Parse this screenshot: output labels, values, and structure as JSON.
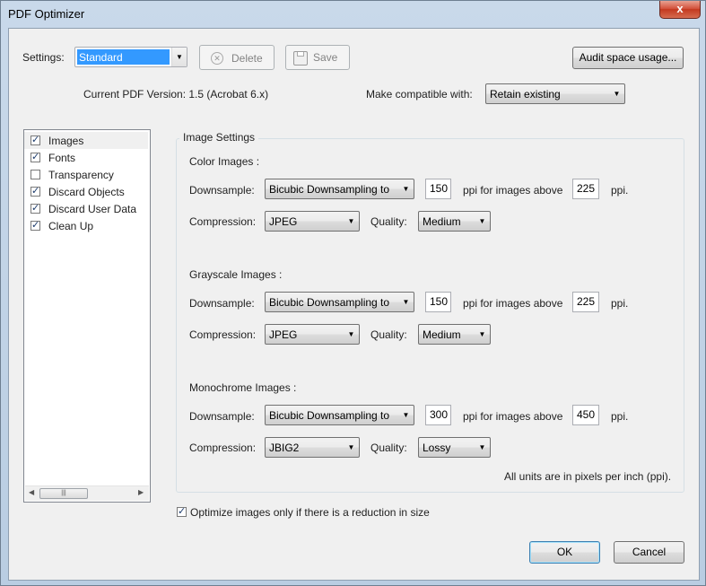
{
  "window": {
    "title": "PDF Optimizer",
    "close_glyph": "x"
  },
  "settings": {
    "label": "Settings:",
    "value": "Standard",
    "delete_label": "Delete",
    "save_label": "Save",
    "audit_label": "Audit space usage..."
  },
  "version": {
    "current_text": "Current PDF Version: 1.5 (Acrobat 6.x)",
    "compat_label": "Make compatible with:",
    "compat_value": "Retain existing"
  },
  "panel_list": {
    "items": [
      {
        "label": "Images",
        "checked": true
      },
      {
        "label": "Fonts",
        "checked": true
      },
      {
        "label": "Transparency",
        "checked": false
      },
      {
        "label": "Discard Objects",
        "checked": true
      },
      {
        "label": "Discard User Data",
        "checked": true
      },
      {
        "label": "Clean Up",
        "checked": true
      }
    ],
    "check_glyph": "✓",
    "scroll_thumb_glyph": "|||"
  },
  "image_settings": {
    "title": "Image Settings",
    "color": {
      "heading": "Color Images :",
      "downsample_label": "Downsample:",
      "downsample_value": "Bicubic Downsampling to",
      "ppi": "150",
      "above_label": "ppi for images above",
      "above_ppi": "225",
      "ppi_suffix": "ppi.",
      "compression_label": "Compression:",
      "compression_value": "JPEG",
      "quality_label": "Quality:",
      "quality_value": "Medium"
    },
    "grayscale": {
      "heading": "Grayscale Images :",
      "downsample_label": "Downsample:",
      "downsample_value": "Bicubic Downsampling to",
      "ppi": "150",
      "above_label": "ppi for images above",
      "above_ppi": "225",
      "ppi_suffix": "ppi.",
      "compression_label": "Compression:",
      "compression_value": "JPEG",
      "quality_label": "Quality:",
      "quality_value": "Medium"
    },
    "monochrome": {
      "heading": "Monochrome Images :",
      "downsample_label": "Downsample:",
      "downsample_value": "Bicubic Downsampling to",
      "ppi": "300",
      "above_label": "ppi for images above",
      "above_ppi": "450",
      "ppi_suffix": "ppi.",
      "compression_label": "Compression:",
      "compression_value": "JBIG2",
      "quality_label": "Quality:",
      "quality_value": "Lossy"
    },
    "units_note": "All units are in pixels per inch (ppi)."
  },
  "optimize_option": {
    "label": "Optimize images only if there is a reduction in size",
    "checked": true
  },
  "buttons": {
    "ok": "OK",
    "cancel": "Cancel"
  },
  "dropdown_glyph": "▼"
}
